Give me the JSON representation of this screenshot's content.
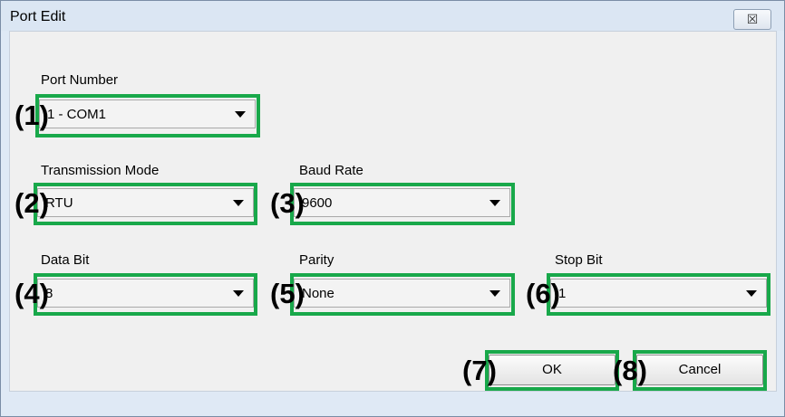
{
  "window": {
    "title": "Port Edit",
    "close_glyph": "☒"
  },
  "fields": {
    "port_number": {
      "label": "Port Number",
      "value": "1 - COM1"
    },
    "transmission_mode": {
      "label": "Transmission Mode",
      "value": "RTU"
    },
    "baud_rate": {
      "label": "Baud Rate",
      "value": "9600"
    },
    "data_bit": {
      "label": "Data Bit",
      "value": "8"
    },
    "parity": {
      "label": "Parity",
      "value": "None"
    },
    "stop_bit": {
      "label": "Stop Bit",
      "value": "1"
    }
  },
  "buttons": {
    "ok": "OK",
    "cancel": "Cancel"
  },
  "callouts": [
    "(1)",
    "(2)",
    "(3)",
    "(4)",
    "(5)",
    "(6)",
    "(7)",
    "(8)"
  ],
  "colors": {
    "highlight": "#18a84a",
    "titlebar": "#dbe6f3",
    "dialog_bg": "#f0f0f0"
  },
  "icons": {
    "dropdown_arrow": "chevron-down-icon",
    "close": "close-icon"
  }
}
